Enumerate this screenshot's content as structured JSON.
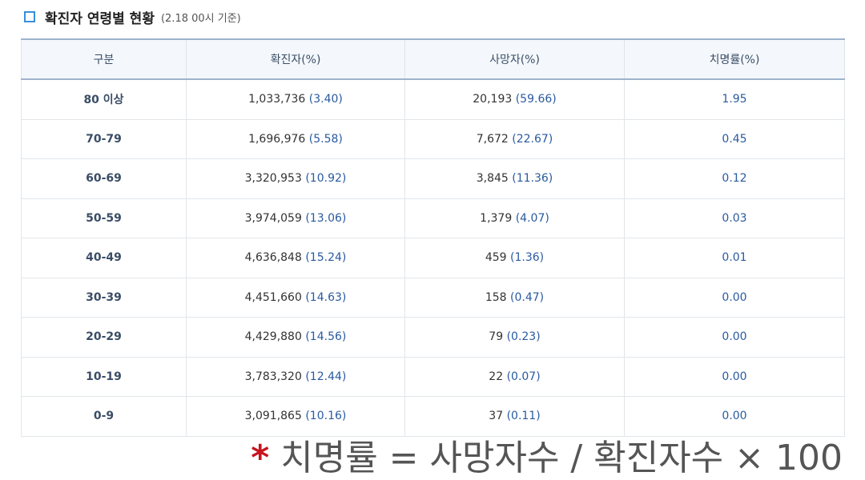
{
  "header": {
    "title": "확진자 연령별 현황",
    "subtitle": "(2.18 00시 기준)"
  },
  "table": {
    "columns": [
      "구분",
      "확진자(%)",
      "사망자(%)",
      "치명률(%)"
    ],
    "rows": [
      {
        "age": "80 이상",
        "cases": "1,033,736",
        "cases_pct": "(3.40)",
        "deaths": "20,193",
        "deaths_pct": "(59.66)",
        "cfr": "1.95"
      },
      {
        "age": "70-79",
        "cases": "1,696,976",
        "cases_pct": "(5.58)",
        "deaths": "7,672",
        "deaths_pct": "(22.67)",
        "cfr": "0.45"
      },
      {
        "age": "60-69",
        "cases": "3,320,953",
        "cases_pct": "(10.92)",
        "deaths": "3,845",
        "deaths_pct": "(11.36)",
        "cfr": "0.12"
      },
      {
        "age": "50-59",
        "cases": "3,974,059",
        "cases_pct": "(13.06)",
        "deaths": "1,379",
        "deaths_pct": "(4.07)",
        "cfr": "0.03"
      },
      {
        "age": "40-49",
        "cases": "4,636,848",
        "cases_pct": "(15.24)",
        "deaths": "459",
        "deaths_pct": "(1.36)",
        "cfr": "0.01"
      },
      {
        "age": "30-39",
        "cases": "4,451,660",
        "cases_pct": "(14.63)",
        "deaths": "158",
        "deaths_pct": "(0.47)",
        "cfr": "0.00"
      },
      {
        "age": "20-29",
        "cases": "4,429,880",
        "cases_pct": "(14.56)",
        "deaths": "79",
        "deaths_pct": "(0.23)",
        "cfr": "0.00"
      },
      {
        "age": "10-19",
        "cases": "3,783,320",
        "cases_pct": "(12.44)",
        "deaths": "22",
        "deaths_pct": "(0.07)",
        "cfr": "0.00"
      },
      {
        "age": "0-9",
        "cases": "3,091,865",
        "cases_pct": "(10.16)",
        "deaths": "37",
        "deaths_pct": "(0.11)",
        "cfr": "0.00"
      }
    ]
  },
  "footnote": {
    "star": "*",
    "text": "치명률 = 사망자수 / 확진자수 × 100"
  },
  "colors": {
    "accent": "#3a8ed8",
    "percent_text": "#2a5aa0",
    "star": "#c8141e"
  }
}
